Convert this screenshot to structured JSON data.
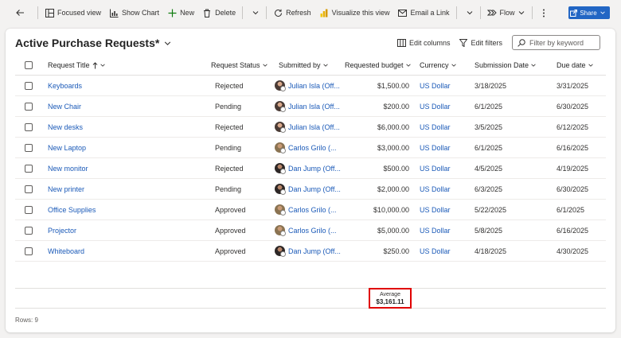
{
  "toolbar": {
    "focused_view": "Focused view",
    "show_chart": "Show Chart",
    "new": "New",
    "delete": "Delete",
    "refresh": "Refresh",
    "visualize": "Visualize this view",
    "email_link": "Email a Link",
    "flow": "Flow",
    "share": "Share"
  },
  "view": {
    "title": "Active Purchase Requests*",
    "edit_columns": "Edit columns",
    "edit_filters": "Edit filters",
    "filter_placeholder": "Filter by keyword"
  },
  "columns": {
    "title": "Request Title",
    "status": "Request Status",
    "submitted_by": "Submitted by",
    "budget": "Requested budget",
    "currency": "Currency",
    "submission_date": "Submission Date",
    "due_date": "Due date"
  },
  "rows": [
    {
      "title": "Keyboards",
      "status": "Rejected",
      "submitted_by": "Julian Isla (Off...",
      "avatar": "julian",
      "budget": "$1,500.00",
      "currency": "US Dollar",
      "submission_date": "3/18/2025",
      "due_date": "3/31/2025"
    },
    {
      "title": "New Chair",
      "status": "Pending",
      "submitted_by": "Julian Isla (Off...",
      "avatar": "julian",
      "budget": "$200.00",
      "currency": "US Dollar",
      "submission_date": "6/1/2025",
      "due_date": "6/30/2025"
    },
    {
      "title": "New desks",
      "status": "Rejected",
      "submitted_by": "Julian Isla (Off...",
      "avatar": "julian",
      "budget": "$6,000.00",
      "currency": "US Dollar",
      "submission_date": "3/5/2025",
      "due_date": "6/12/2025"
    },
    {
      "title": "New Laptop",
      "status": "Pending",
      "submitted_by": "Carlos Grilo (...",
      "avatar": "carlos",
      "budget": "$3,000.00",
      "currency": "US Dollar",
      "submission_date": "6/1/2025",
      "due_date": "6/16/2025"
    },
    {
      "title": "New monitor",
      "status": "Rejected",
      "submitted_by": "Dan Jump (Off...",
      "avatar": "dan",
      "budget": "$500.00",
      "currency": "US Dollar",
      "submission_date": "4/5/2025",
      "due_date": "4/19/2025"
    },
    {
      "title": "New printer",
      "status": "Pending",
      "submitted_by": "Dan Jump (Off...",
      "avatar": "dan",
      "budget": "$2,000.00",
      "currency": "US Dollar",
      "submission_date": "6/3/2025",
      "due_date": "6/30/2025"
    },
    {
      "title": "Office Supplies",
      "status": "Approved",
      "submitted_by": "Carlos Grilo (...",
      "avatar": "carlos",
      "budget": "$10,000.00",
      "currency": "US Dollar",
      "submission_date": "5/22/2025",
      "due_date": "6/1/2025"
    },
    {
      "title": "Projector",
      "status": "Approved",
      "submitted_by": "Carlos Grilo (...",
      "avatar": "carlos",
      "budget": "$5,000.00",
      "currency": "US Dollar",
      "submission_date": "5/8/2025",
      "due_date": "6/16/2025"
    },
    {
      "title": "Whiteboard",
      "status": "Approved",
      "submitted_by": "Dan Jump (Off...",
      "avatar": "dan",
      "budget": "$250.00",
      "currency": "US Dollar",
      "submission_date": "4/18/2025",
      "due_date": "4/30/2025"
    }
  ],
  "aggregate": {
    "label": "Average",
    "value": "$3,161.11"
  },
  "footer": {
    "rows_count": "Rows: 9"
  },
  "colors": {
    "link": "#1b5ab8",
    "share": "#2266c4",
    "highlight": "#e00000"
  }
}
